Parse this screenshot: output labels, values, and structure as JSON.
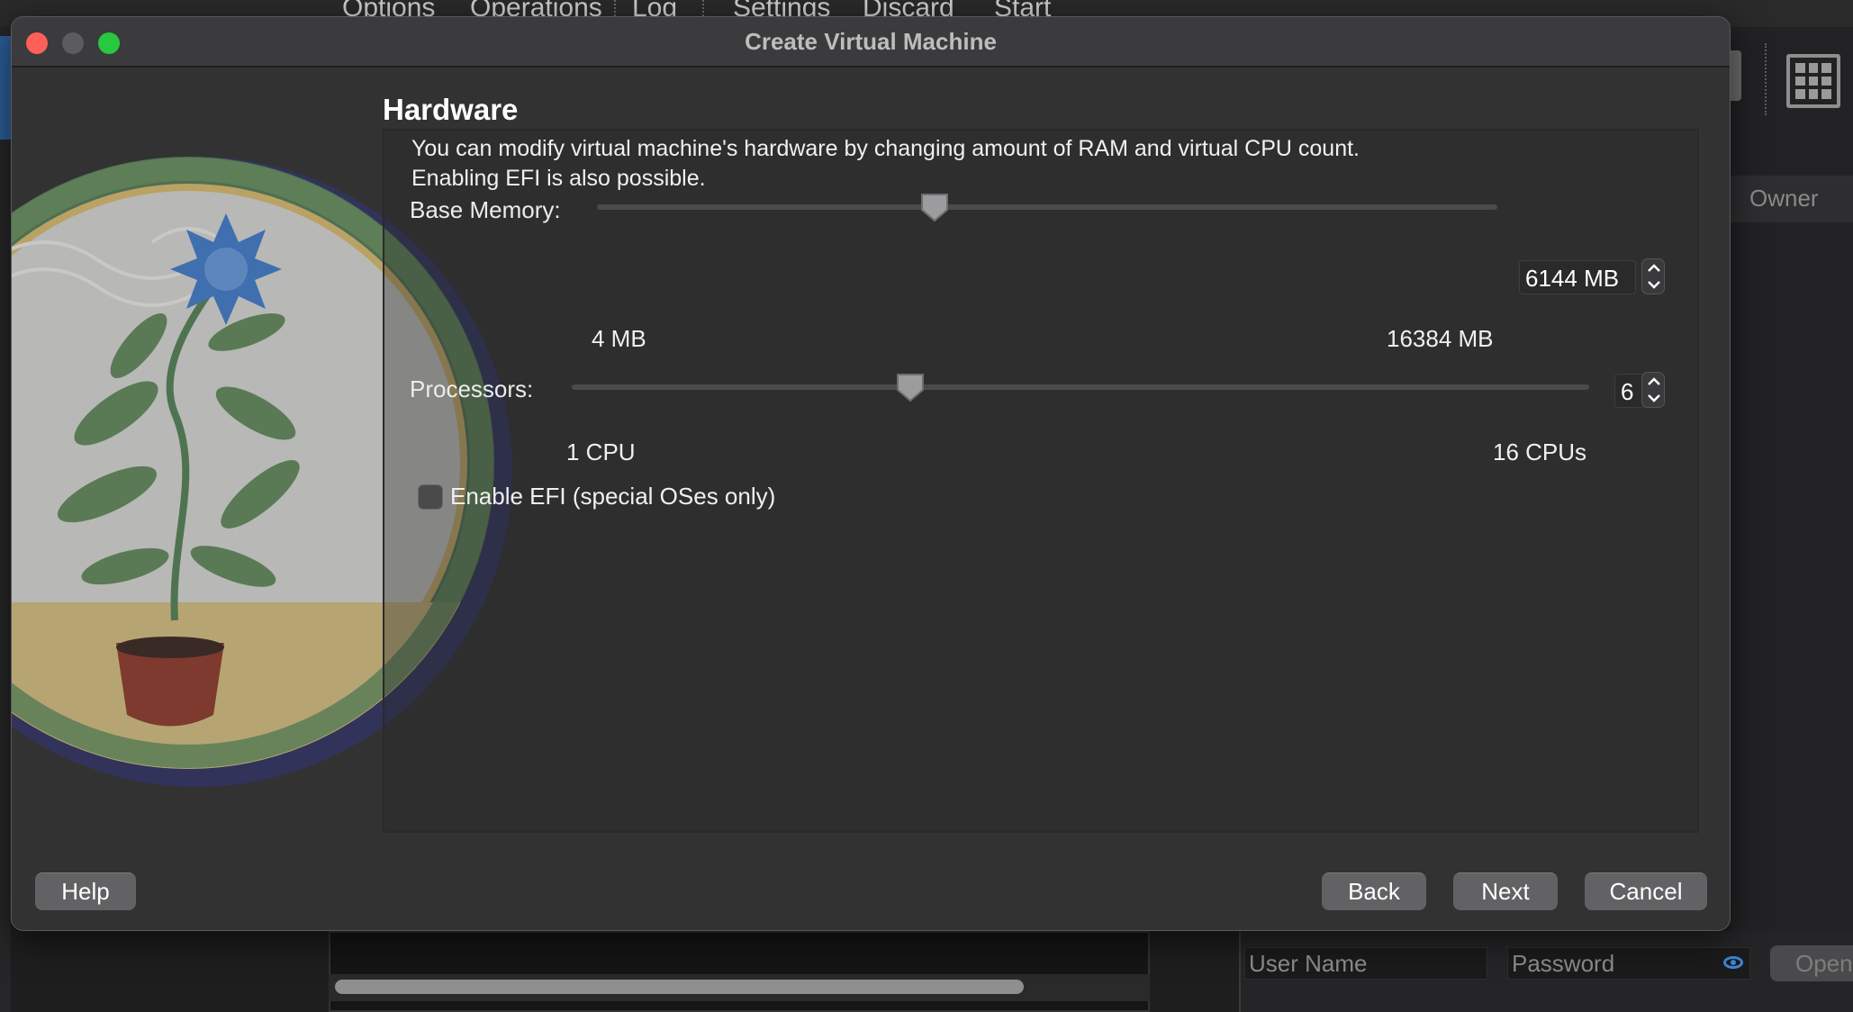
{
  "background_app": {
    "menu": [
      "Options",
      "Operations",
      "Log",
      "Settings",
      "Discard",
      "Start"
    ],
    "owner_header": "Owner",
    "username_placeholder": "User Name",
    "password_placeholder": "Password",
    "open_label": "Open"
  },
  "dialog": {
    "title": "Create Virtual Machine",
    "page_title": "Hardware",
    "description": [
      "You can modify virtual machine's hardware by changing amount of RAM and virtual CPU count.",
      "Enabling EFI is also possible."
    ],
    "memory": {
      "label": "Base Memory:",
      "value": "6144 MB",
      "min_label": "4 MB",
      "max_label": "16384 MB",
      "fraction": 0.375
    },
    "processors": {
      "label": "Processors:",
      "value": "6",
      "min_label": "1 CPU",
      "max_label": "16 CPUs",
      "fraction": 0.333
    },
    "efi": {
      "label": "Enable EFI (special OSes only)",
      "checked": false
    },
    "buttons": {
      "help": "Help",
      "back": "Back",
      "next": "Next",
      "cancel": "Cancel"
    }
  },
  "colors": {
    "close": "#fe5f57",
    "minimize": "#5c5b5d",
    "maximize": "#28c840",
    "dialog_bg": "#323233",
    "button_bg": "#626264"
  }
}
